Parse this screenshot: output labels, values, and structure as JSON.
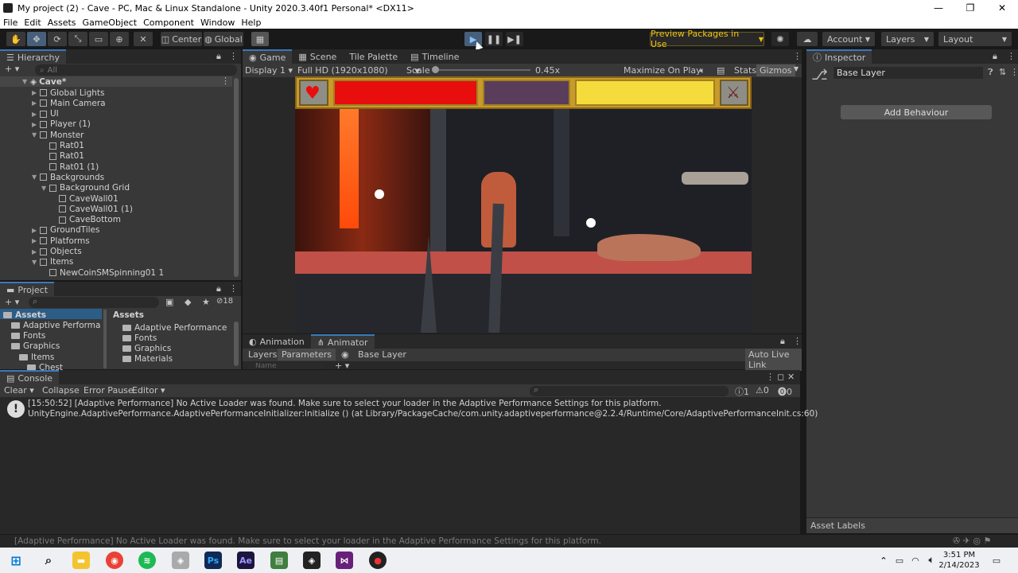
{
  "window": {
    "title": "My project (2) - Cave - PC, Mac & Linux Standalone - Unity 2020.3.40f1 Personal* <DX11>",
    "minimize": "—",
    "maximize": "❐",
    "close": "✕"
  },
  "menu": [
    "File",
    "Edit",
    "Assets",
    "GameObject",
    "Component",
    "Window",
    "Help"
  ],
  "toolbar": {
    "pivot": "Center",
    "space": "Global",
    "preview_packages": "Preview Packages in Use",
    "account": "Account",
    "layers": "Layers",
    "layout": "Layout"
  },
  "hierarchy": {
    "title": "Hierarchy",
    "search_placeholder": "All",
    "scene": "Cave*",
    "items": [
      {
        "label": "Global Lights",
        "depth": 1
      },
      {
        "label": "Main Camera",
        "depth": 1
      },
      {
        "label": "UI",
        "depth": 1
      },
      {
        "label": "Player (1)",
        "depth": 1
      },
      {
        "label": "Monster",
        "depth": 1
      },
      {
        "label": "Rat01",
        "depth": 2
      },
      {
        "label": "Rat01",
        "depth": 2
      },
      {
        "label": "Rat01 (1)",
        "depth": 2
      },
      {
        "label": "Backgrounds",
        "depth": 1
      },
      {
        "label": "Background Grid",
        "depth": 2
      },
      {
        "label": "CaveWall01",
        "depth": 3
      },
      {
        "label": "CaveWall01 (1)",
        "depth": 3
      },
      {
        "label": "CaveBottom",
        "depth": 3
      },
      {
        "label": "GroundTiles",
        "depth": 1
      },
      {
        "label": "Platforms",
        "depth": 1
      },
      {
        "label": "Objects",
        "depth": 1
      },
      {
        "label": "Items",
        "depth": 1
      },
      {
        "label": "NewCoinSMSpinning01 1",
        "depth": 2
      }
    ]
  },
  "project": {
    "title": "Project",
    "hidden_count": "18",
    "tree": [
      "Assets",
      "Adaptive Performa",
      "Fonts",
      "Graphics",
      "Items",
      "Chest"
    ],
    "breadcrumb": "Assets",
    "folders": [
      "Adaptive Performance",
      "Fonts",
      "Graphics",
      "Materials"
    ]
  },
  "game": {
    "tabs": [
      "Game",
      "Scene",
      "Tile Palette",
      "Timeline"
    ],
    "display": "Display 1",
    "resolution": "Full HD (1920x1080)",
    "scale_label": "Scale",
    "scale_value": "0.45x",
    "maximize": "Maximize On Play",
    "stats": "Stats",
    "gizmos": "Gizmos"
  },
  "animator": {
    "tabs": [
      "Animation",
      "Animator"
    ],
    "layers": "Layers",
    "parameters": "Parameters",
    "base_layer": "Base Layer",
    "auto_live_link": "Auto Live Link",
    "name_placeholder": "Name"
  },
  "inspector": {
    "title": "Inspector",
    "name": "Base Layer",
    "add_behaviour": "Add Behaviour",
    "asset_labels": "Asset Labels"
  },
  "console": {
    "title": "Console",
    "clear": "Clear",
    "collapse": "Collapse",
    "error_pause": "Error Pause",
    "editor": "Editor",
    "count_log": "1",
    "count_warn": "0",
    "count_err": "0",
    "message_line1": "[15:50:52] [Adaptive Performance] No Active Loader was found. Make sure to select your loader in the Adaptive Performance Settings for this platform.",
    "message_line2": "UnityEngine.AdaptivePerformance.AdaptivePerformanceInitializer:Initialize () (at Library/PackageCache/com.unity.adaptiveperformance@2.2.4/Runtime/Core/AdaptivePerformanceInit.cs:60)"
  },
  "status_bar": "[Adaptive Performance] No Active Loader was found. Make sure to select your loader in the Adaptive Performance Settings for this platform.",
  "taskbar": {
    "time": "3:51 PM",
    "date": "2/14/2023"
  },
  "colors": {
    "accent_blue": "#3a79bb",
    "play_active": "#46607c",
    "health_red": "#e80e0e",
    "mana_purple": "#5a3d5a",
    "stamina_yellow": "#f5dc3c",
    "hud_gold": "#c89a2a"
  }
}
